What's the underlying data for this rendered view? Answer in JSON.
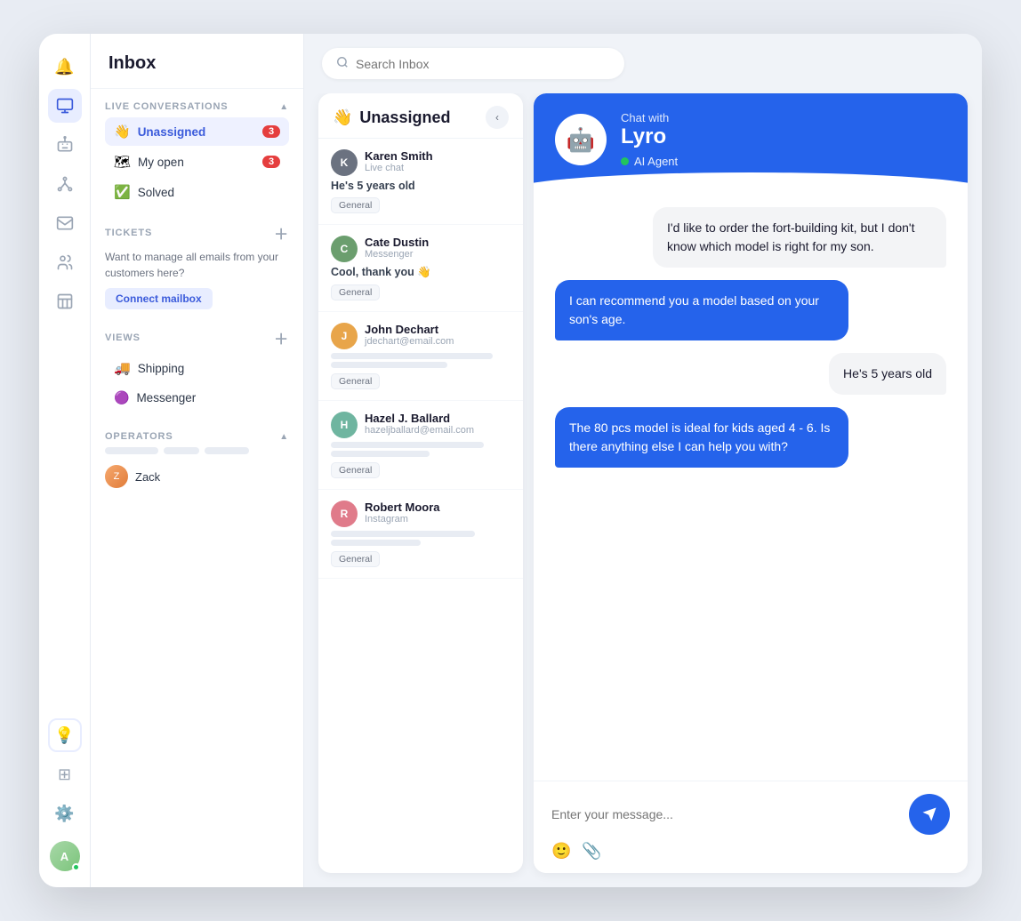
{
  "app": {
    "title": "Inbox"
  },
  "nav_icons": [
    {
      "name": "bell-icon",
      "symbol": "🔔",
      "active": false
    },
    {
      "name": "inbox-icon",
      "symbol": "⊡",
      "active": true
    },
    {
      "name": "bot-icon",
      "symbol": "🤖",
      "active": false
    },
    {
      "name": "network-icon",
      "symbol": "⎈",
      "active": false
    },
    {
      "name": "mail-icon",
      "symbol": "✉",
      "active": false
    },
    {
      "name": "people-icon",
      "symbol": "👥",
      "active": false
    },
    {
      "name": "chart-icon",
      "symbol": "▦",
      "active": false
    }
  ],
  "sidebar": {
    "title": "Inbox",
    "live_conversations": {
      "section_label": "LIVE CONVERSATIONS",
      "items": [
        {
          "label": "Unassigned",
          "icon": "👋",
          "badge": "3",
          "active": true
        },
        {
          "label": "My open",
          "icon": "🗺",
          "badge": "3",
          "active": false
        },
        {
          "label": "Solved",
          "icon": "✅",
          "badge": null,
          "active": false
        }
      ]
    },
    "tickets": {
      "section_label": "TICKETS",
      "connect_text": "Want to manage all emails from your customers here?",
      "connect_btn_label": "Connect mailbox"
    },
    "views": {
      "section_label": "VIEWS",
      "items": [
        {
          "label": "Shipping",
          "icon": "🚚"
        },
        {
          "label": "Messenger",
          "icon": "🟣"
        }
      ]
    },
    "operators": {
      "section_label": "OPERATORS",
      "items": [
        {
          "label": "Zack",
          "initials": "Z"
        }
      ]
    }
  },
  "search": {
    "placeholder": "Search Inbox"
  },
  "conversation_panel": {
    "title": "Unassigned",
    "title_icon": "👋",
    "conversations": [
      {
        "id": "karen-smith",
        "name": "Karen Smith",
        "channel": "Live chat",
        "preview": "He's 5 years old",
        "has_text_preview": true,
        "tag": "General",
        "avatar_bg": "#6b7280",
        "avatar_initials": "K"
      },
      {
        "id": "cate-dustin",
        "name": "Cate Dustin",
        "channel": "Messenger",
        "preview": "Cool, thank you 👋",
        "has_text_preview": true,
        "tag": "General",
        "avatar_bg": "#6b9e6e",
        "avatar_initials": "C"
      },
      {
        "id": "john-dechart",
        "name": "John Dechart",
        "channel": "jdechart@email.com",
        "preview": null,
        "has_text_preview": false,
        "tag": "General",
        "avatar_bg": "#e8a54a",
        "avatar_initials": "J"
      },
      {
        "id": "hazel-ballard",
        "name": "Hazel J. Ballard",
        "channel": "hazeljballard@email.com",
        "preview": null,
        "has_text_preview": false,
        "tag": "General",
        "avatar_bg": "#6fb5a0",
        "avatar_initials": "H"
      },
      {
        "id": "robert-moora",
        "name": "Robert Moora",
        "channel": "Instagram",
        "preview": null,
        "has_text_preview": false,
        "tag": "General",
        "avatar_bg": "#e07b8a",
        "avatar_initials": "R"
      }
    ]
  },
  "chat": {
    "with_label": "Chat with",
    "bot_name": "Lyro",
    "bot_emoji": "🤖",
    "status_label": "AI Agent",
    "messages": [
      {
        "id": "msg1",
        "type": "received",
        "text": "I'd like to order the fort-building kit, but I don't know which model is right for my son."
      },
      {
        "id": "msg2",
        "type": "sent",
        "text": "I can recommend you a model based on your son's age."
      },
      {
        "id": "msg3",
        "type": "received",
        "text": "He's 5 years old"
      },
      {
        "id": "msg4",
        "type": "sent",
        "text": "The 80 pcs model is ideal for kids aged 4 - 6. Is there anything else I can help you with?"
      }
    ],
    "input_placeholder": "Enter your message...",
    "send_btn_label": "Send"
  },
  "bottom_icons": [
    {
      "name": "lightbulb-icon",
      "symbol": "💡"
    },
    {
      "name": "grid-icon",
      "symbol": "⊞"
    },
    {
      "name": "settings-icon",
      "symbol": "⚙"
    }
  ]
}
